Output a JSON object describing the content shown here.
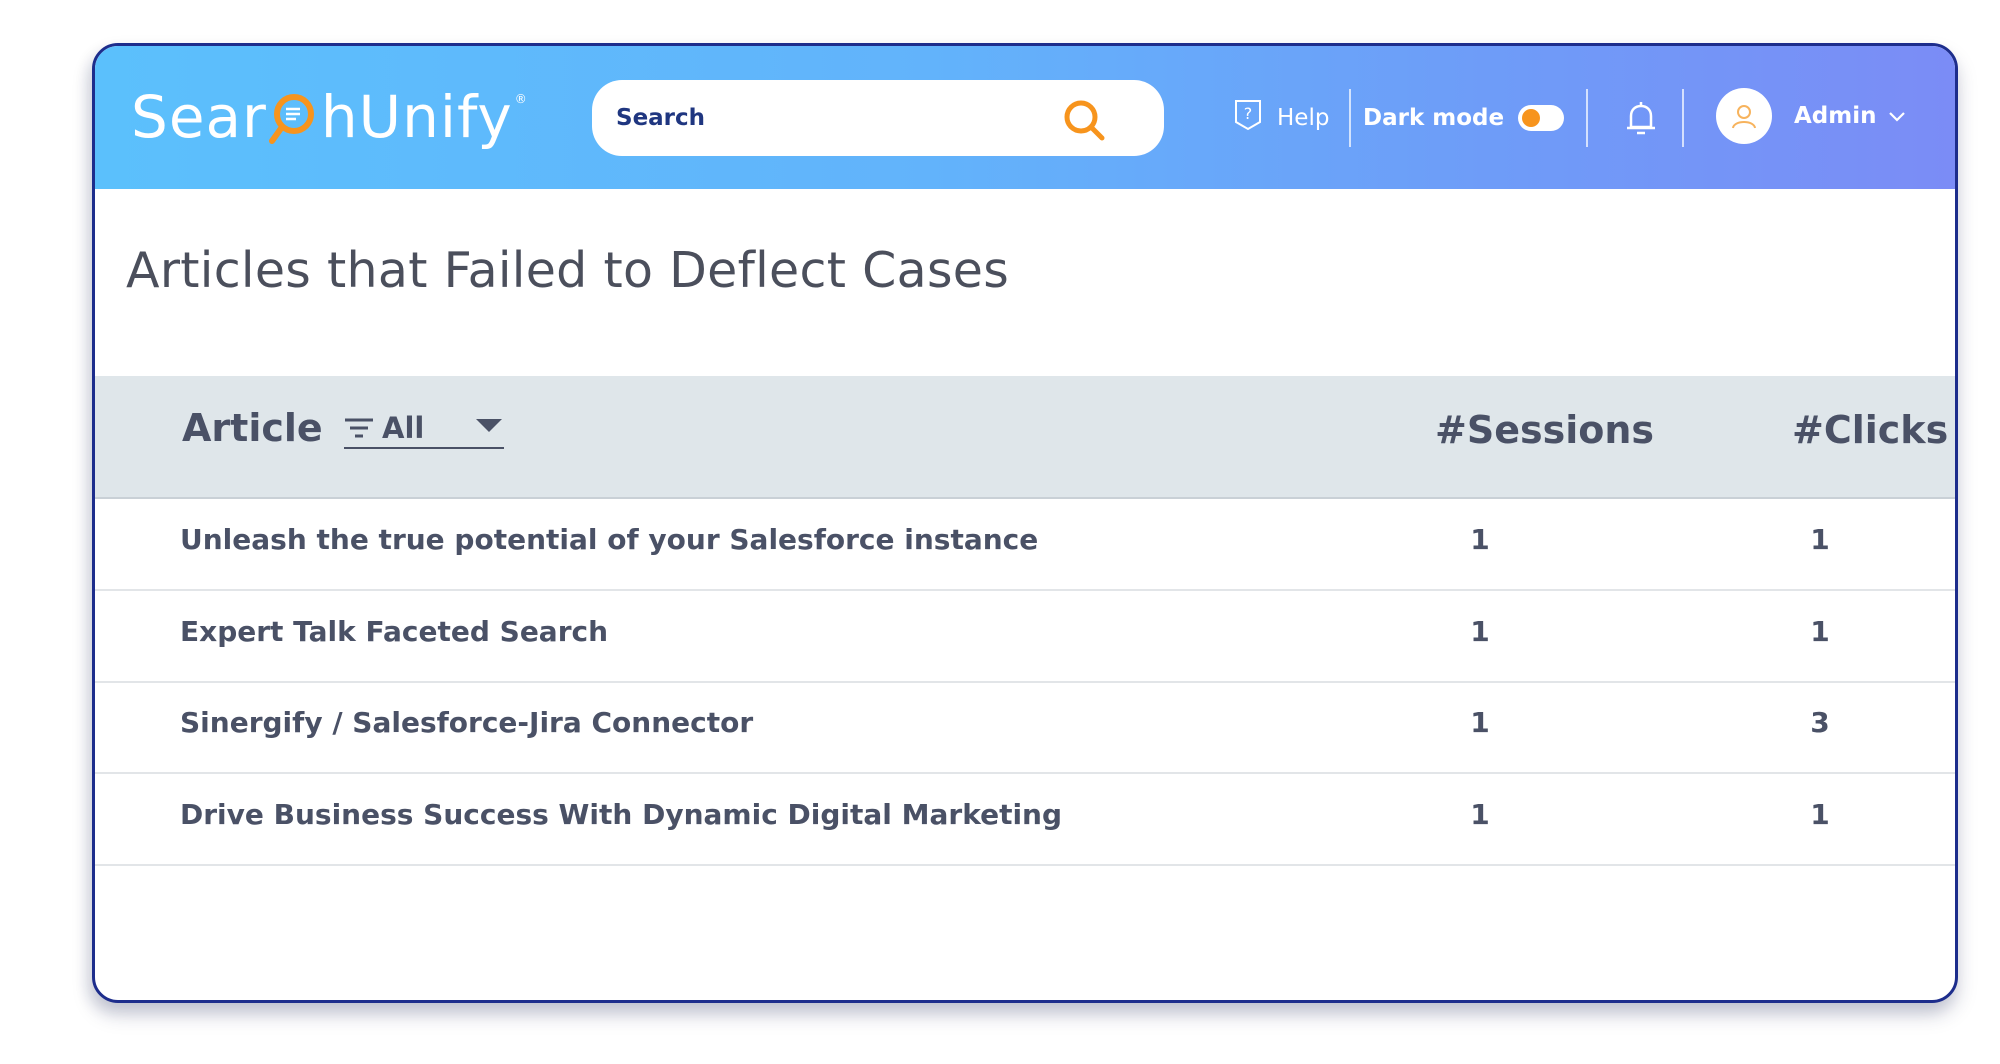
{
  "header": {
    "logo_text_before": "Sear",
    "logo_text_after": "hUnify",
    "logo_registered": "®",
    "search": {
      "placeholder": "Search",
      "icon": "search-icon"
    },
    "help_label": "Help",
    "help_icon": "help-shield-icon",
    "dark_mode_label": "Dark mode",
    "dark_mode_on": false,
    "bell_icon": "bell-icon",
    "user_label": "Admin",
    "colors": {
      "gradient_start": "#5bc0fc",
      "gradient_end": "#7b8cf6",
      "accent": "#f7941d"
    }
  },
  "page": {
    "title": "Articles that Failed to Deflect Cases"
  },
  "table": {
    "columns": {
      "article": "Article",
      "sessions": "#Sessions",
      "clicks": "#Clicks"
    },
    "filter": {
      "value": "All",
      "icon": "filter-icon"
    },
    "rows": [
      {
        "title": "Unleash the true potential of your Salesforce instance",
        "sessions": "1",
        "clicks": "1"
      },
      {
        "title": "Expert Talk Faceted Search",
        "sessions": "1",
        "clicks": "1"
      },
      {
        "title": "Sinergify / Salesforce-Jira Connector",
        "sessions": "1",
        "clicks": "3"
      },
      {
        "title": "Drive Business Success With Dynamic Digital Marketing",
        "sessions": "1",
        "clicks": "1"
      }
    ]
  }
}
